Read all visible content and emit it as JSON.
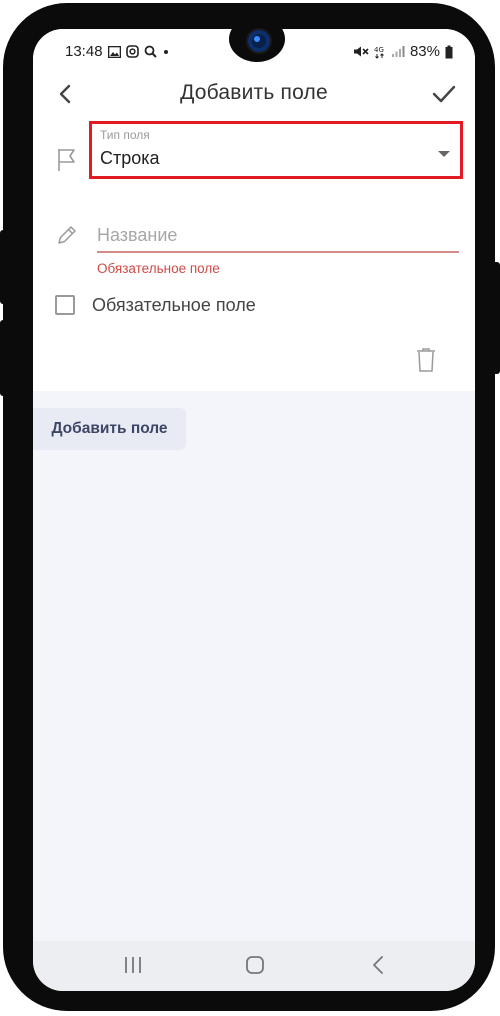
{
  "statusbar": {
    "time": "13:48",
    "left_icons": [
      "gallery-icon",
      "instagram-icon",
      "search-icon",
      "dot"
    ],
    "right_icons": [
      "mute-icon",
      "4g-icon",
      "signal-icon"
    ],
    "battery": "83%"
  },
  "header": {
    "title": "Добавить поле",
    "back_icon": "chevron-left-icon",
    "confirm_icon": "check-icon"
  },
  "form": {
    "field_type": {
      "label": "Тип поля",
      "value": "Строка",
      "icon": "flag-icon"
    },
    "name": {
      "placeholder": "Название",
      "value": "",
      "error": "Обязательное поле",
      "icon": "pencil-icon"
    },
    "required": {
      "label": "Обязательное поле",
      "checked": false
    },
    "delete_icon": "trash-icon"
  },
  "add_field_button": "Добавить поле",
  "navbar": {
    "icons": [
      "recents-icon",
      "home-icon",
      "back-icon"
    ]
  },
  "colors": {
    "highlight_border": "#e01b24",
    "error": "#cf4a45",
    "button_bg": "#e8ebf3",
    "button_text": "#3d4666",
    "background": "#f3f5fb"
  }
}
